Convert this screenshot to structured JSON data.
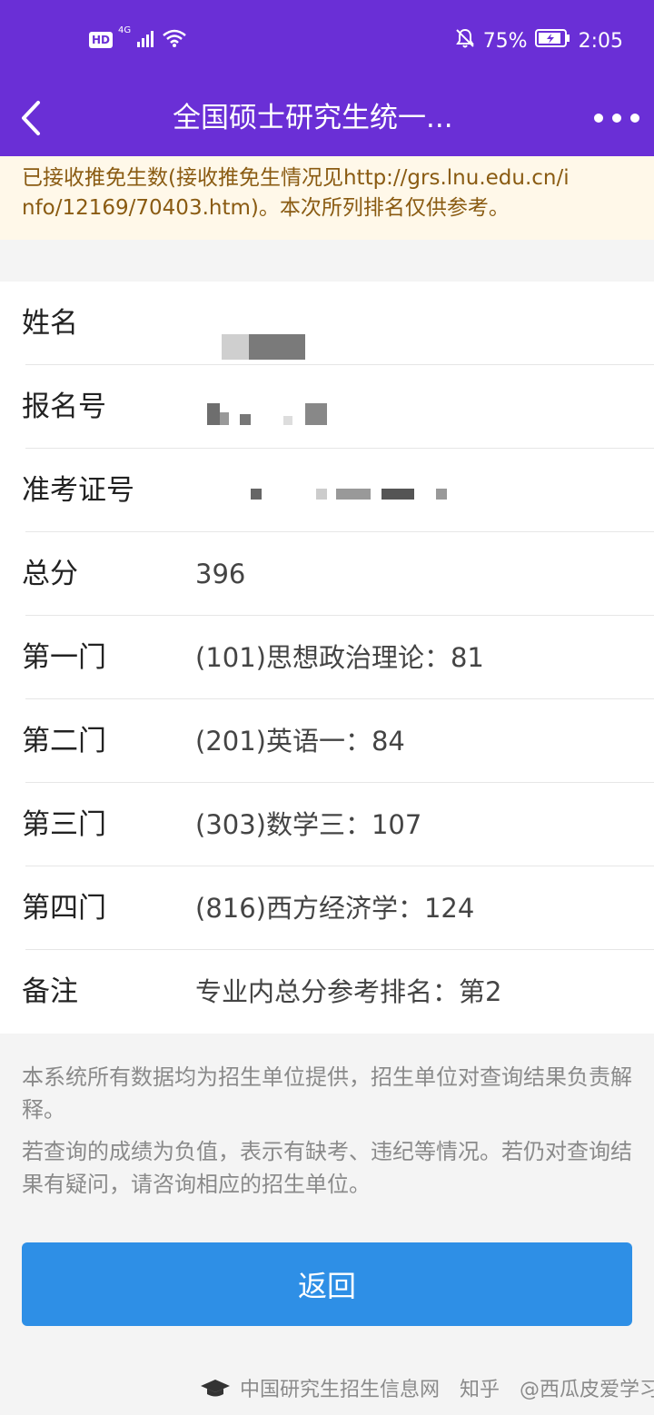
{
  "status_bar": {
    "hd": "HD",
    "network": "4G",
    "battery": "75%",
    "time": "2:05"
  },
  "nav": {
    "title": "全国硕士研究生统一..."
  },
  "notice": {
    "line1": "已接收推免生数(接收推免生情况见http://grs.lnu.edu.cn/i",
    "line2": "nfo/12169/70403.htm)。本次所列排名仅供参考。"
  },
  "info": {
    "name_label": "姓名",
    "reg_label": "报名号",
    "admit_label": "准考证号",
    "total_label": "总分",
    "total_value": "396",
    "subject1_label": "第一门",
    "subject1_value": "(101)思想政治理论：81",
    "subject2_label": "第二门",
    "subject2_value": "(201)英语一：84",
    "subject3_label": "第三门",
    "subject3_value": "(303)数学三：107",
    "subject4_label": "第四门",
    "subject4_value": "(816)西方经济学：124",
    "remark_label": "备注",
    "remark_value": "专业内总分参考排名：第2"
  },
  "disclaimer": {
    "p1": "本系统所有数据均为招生单位提供，招生单位对查询结果负责解释。",
    "p2": "若查询的成绩为负值，表示有缺考、违纪等情况。若仍对查询结果有疑问，请咨询相应的招生单位。"
  },
  "return_label": "返回",
  "footer": {
    "site": "中国研究生招生信息网",
    "platform": "知乎",
    "author": "@西瓜皮爱学习"
  },
  "colors": {
    "header_bg": "#6a2fd6",
    "notice_bg": "#fff8e9",
    "button_bg": "#2e8fe6"
  }
}
